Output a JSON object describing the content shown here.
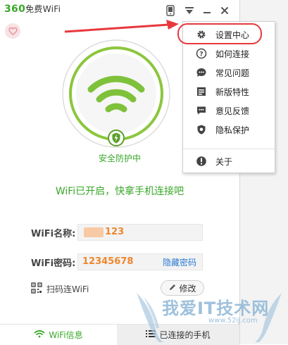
{
  "app": {
    "logo_number": "360",
    "logo_text": "免费WiFi"
  },
  "main": {
    "status_label": "安全防护中",
    "message": "WiFi已开启，快拿手机连接吧",
    "ssid_label": "WiFi名称:",
    "ssid_value": "123",
    "password_label": "WiFi密码:",
    "password_value": "12345678",
    "hide_password": "隐藏密码",
    "qr_label": "扫码连WiFi",
    "edit_label": "修改"
  },
  "tabs": {
    "wifi_info": "WiFi信息",
    "connected_phones": "已连接的手机"
  },
  "menu": {
    "items": [
      {
        "label": "设置中心",
        "icon": "gear-icon"
      },
      {
        "label": "如何连接",
        "icon": "question-icon"
      },
      {
        "label": "常见问题",
        "icon": "chat-icon"
      },
      {
        "label": "新版特性",
        "icon": "list-icon"
      },
      {
        "label": "意见反馈",
        "icon": "feedback-icon"
      },
      {
        "label": "隐私保护",
        "icon": "privacy-shield-icon"
      },
      {
        "label": "关于",
        "icon": "info-icon"
      }
    ]
  },
  "watermark": {
    "text": "我爱IT技术网",
    "url": "www.52ij.com"
  },
  "colors": {
    "brand_green": "#3aa82a",
    "orange": "#f0862b",
    "link_blue": "#2d7bd2",
    "highlight_red": "#e8383d"
  }
}
